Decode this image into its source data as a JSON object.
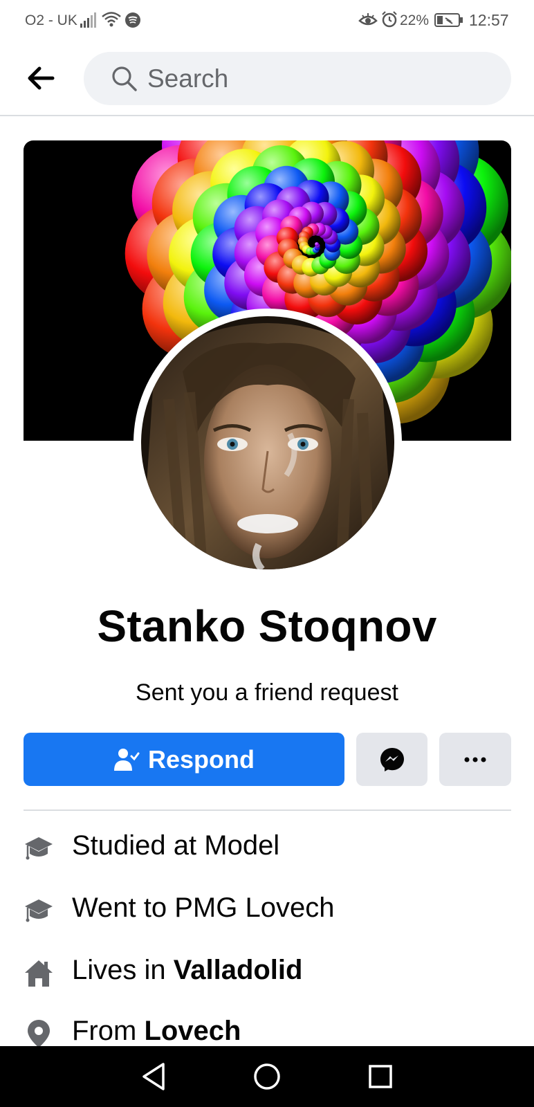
{
  "status_bar": {
    "carrier": "O2 - UK",
    "battery_percent": "22%",
    "time": "12:57",
    "icons": [
      "signal-icon",
      "wifi-icon",
      "spotify-icon",
      "eye-comfort-icon",
      "alarm-icon",
      "battery-icon"
    ]
  },
  "header": {
    "back_icon": "arrow-left-icon",
    "search_placeholder": "Search"
  },
  "profile": {
    "name": "Stanko Stoqnov",
    "status": "Sent you a friend request"
  },
  "actions": {
    "respond_label": "Respond",
    "respond_icon": "person-check-icon",
    "messenger_icon": "messenger-icon",
    "more_icon": "more-dots-icon"
  },
  "details": [
    {
      "icon": "graduation-cap-icon",
      "text": "Studied at Model",
      "bold": ""
    },
    {
      "icon": "graduation-cap-icon",
      "text": "Went to PMG Lovech",
      "bold": ""
    },
    {
      "icon": "home-icon",
      "text": "Lives in ",
      "bold": "Valladolid"
    },
    {
      "icon": "location-pin-icon",
      "text": "From ",
      "bold": "Lovech"
    }
  ],
  "colors": {
    "primary": "#1877f2",
    "secondary_button": "#e4e6eb",
    "search_bg": "#f0f2f5",
    "text": "#050505",
    "icon_gray": "#65676b"
  },
  "navbar": {
    "icons": [
      "back-triangle-icon",
      "home-circle-icon",
      "recents-square-icon"
    ]
  }
}
